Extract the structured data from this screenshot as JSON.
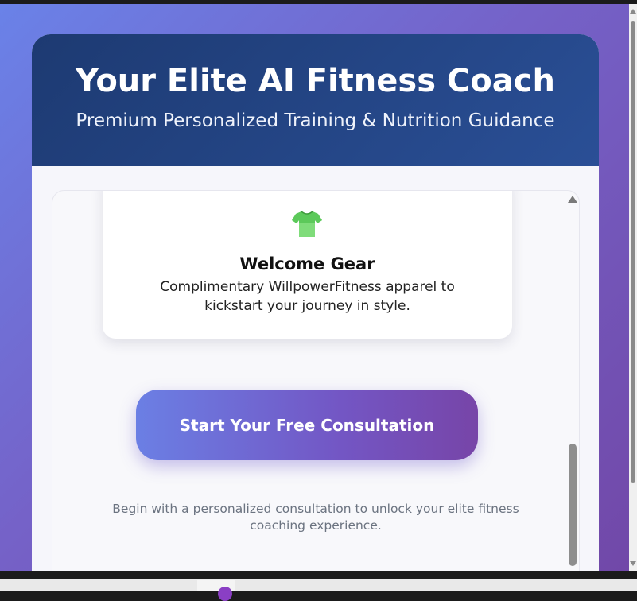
{
  "header": {
    "title": "Your Elite AI Fitness Coach",
    "subtitle": "Premium Personalized Training & Nutrition Guidance"
  },
  "feature": {
    "icon": "t-shirt-icon",
    "title": "Welcome Gear",
    "description": "Complimentary WillpowerFitness apparel to kickstart your journey in style."
  },
  "cta": {
    "button_label": "Start Your Free Consultation",
    "note": "Begin with a personalized consultation to unlock your elite fitness coaching experience."
  },
  "colors": {
    "header_bg": "#1d3a72",
    "background_gradient_start": "#6a82e8",
    "background_gradient_end": "#7148a8",
    "cta_gradient_start": "#6b7fe4",
    "cta_gradient_end": "#7745a8",
    "shirt_green": "#7fdc7a"
  }
}
